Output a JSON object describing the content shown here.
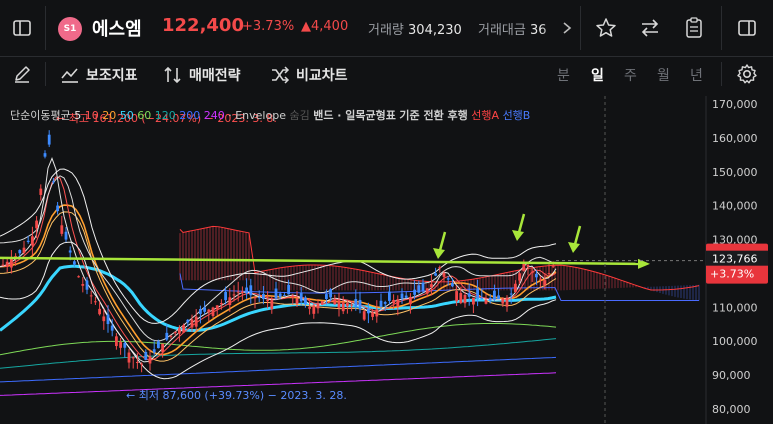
{
  "header": {
    "logo_text": "S1",
    "name": "에스엠",
    "price": "122,400",
    "change_pct": "+3.73%",
    "change_abs": "▲4,400",
    "volume_label": "거래량",
    "volume": "304,230",
    "amount_label": "거래대금",
    "amount": "36"
  },
  "toolbar": {
    "indicators_label": "보조지표",
    "strategy_label": "매매전략",
    "compare_label": "비교차트",
    "periods": [
      "분",
      "일",
      "주",
      "월",
      "년"
    ],
    "active_period": "일"
  },
  "legend": {
    "ma_label": "단순이동평균",
    "ma_periods": [
      {
        "text": "5",
        "color": "#e6e6e6"
      },
      {
        "text": "10",
        "color": "#ff5252"
      },
      {
        "text": "20",
        "color": "#ff9f2e"
      },
      {
        "text": "50",
        "color": "#39d6ff"
      },
      {
        "text": "60",
        "color": "#7ed957"
      },
      {
        "text": "120",
        "color": "#16a6a0"
      },
      {
        "text": "200",
        "color": "#3d6cff"
      },
      {
        "text": "240",
        "color": "#cc33ff"
      }
    ],
    "envelope_label": "· Envelope",
    "envelope_hidden": "숨김",
    "band_label": "밴드 · 일목균형표",
    "ichimoku_terms": "기준 전환 후행",
    "span_a": "선행A",
    "span_b": "선행B"
  },
  "annotations": {
    "high": "← 최고 161,200 (−24.07%) − 2023. 3. 8.",
    "low": "← 최저 87,600 (+39.73%) − 2023. 3. 28."
  },
  "price_axis": {
    "ticks": [
      "170,000",
      "160,000",
      "150,000",
      "140,000",
      "130,000",
      "120,000",
      "110,000",
      "100,000",
      "90,000",
      "80,000"
    ],
    "current_tag": "123,766",
    "current_sub": "+3.73%"
  },
  "colors": {
    "up": "#f34a4a",
    "down": "#3d8bff",
    "trend_line": "#a8e63a",
    "ma50": "#39d6ff"
  },
  "chart_data": {
    "type": "candlestick",
    "y_range": [
      78000,
      173000
    ],
    "high_point": {
      "value": 161200,
      "date": "2023. 3. 8."
    },
    "low_point": {
      "value": 87600,
      "date": "2023. 3. 28."
    },
    "current_value": 123766,
    "resistance_level": 124000
  }
}
